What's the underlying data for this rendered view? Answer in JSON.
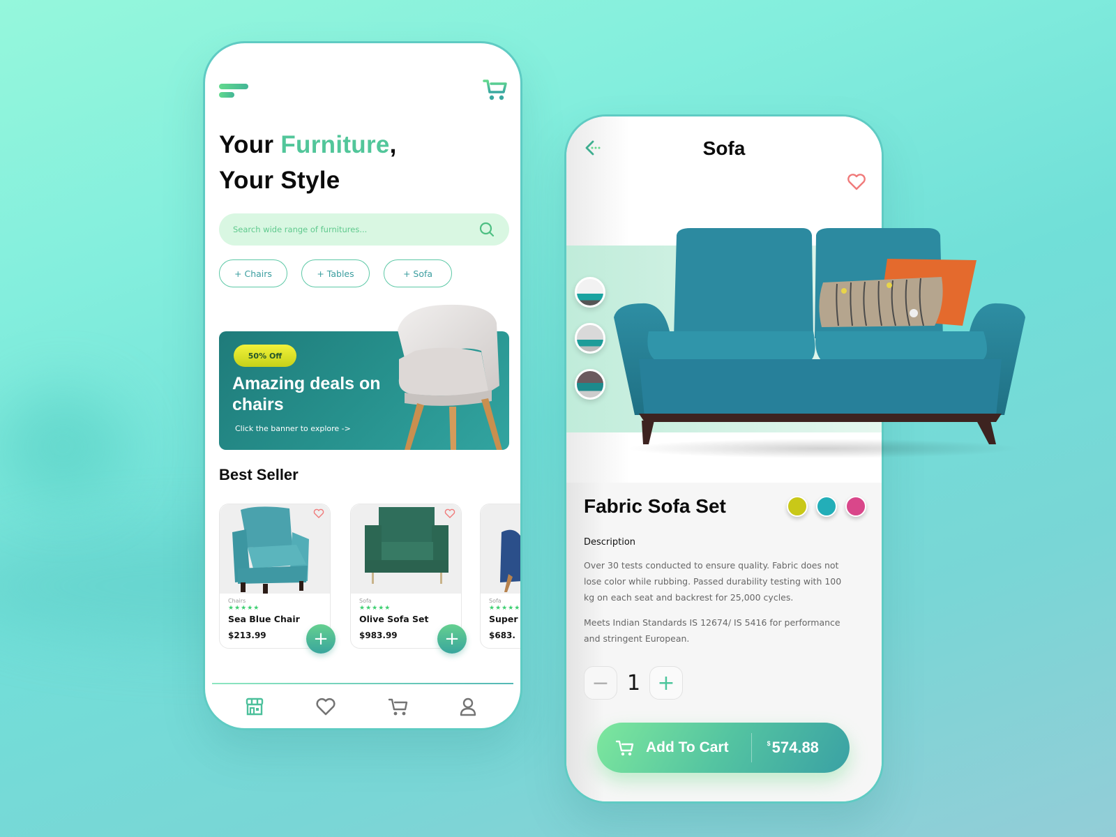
{
  "home": {
    "hero": {
      "line1_prefix": "Your ",
      "line1_accent": "Furniture",
      "line1_suffix": ",",
      "line2": "Your Style"
    },
    "search": {
      "placeholder": "Search wide range of furnitures..."
    },
    "chips": [
      "+ Chairs",
      "+ Tables",
      "+ Sofa"
    ],
    "banner": {
      "badge": "50% Off",
      "title": "Amazing deals on chairs",
      "link": "Click the banner to explore ->"
    },
    "best_seller": {
      "title": "Best Seller",
      "products": [
        {
          "category": "Chairs",
          "stars": "★★★★★",
          "name": "Sea Blue Chair",
          "price": "$213.99"
        },
        {
          "category": "Sofa",
          "stars": "★★★★★",
          "name": "Olive Sofa Set",
          "price": "$983.99"
        },
        {
          "category": "Sofa",
          "stars": "★★★★★",
          "name": "Super",
          "price": "$683."
        }
      ]
    },
    "bottom_nav": [
      "store-icon",
      "heart-icon",
      "cart-icon",
      "user-icon"
    ]
  },
  "detail": {
    "title": "Sofa",
    "product_name": "Fabric Sofa Set",
    "colors": [
      "#c9c818",
      "#23aeb8",
      "#d9478a"
    ],
    "description_label": "Description",
    "description_1": "Over 30 tests conducted to ensure quality. Fabric does not lose color while rubbing. Passed durability testing with 100 kg on each seat and backrest for 25,000 cycles.",
    "description_2": "Meets Indian Standards IS 12674/ IS 5416 for performance and stringent European.",
    "quantity": "1",
    "minus": "−",
    "plus": "+",
    "add_to_cart": "Add To Cart",
    "currency": "$",
    "price": "574.88"
  }
}
